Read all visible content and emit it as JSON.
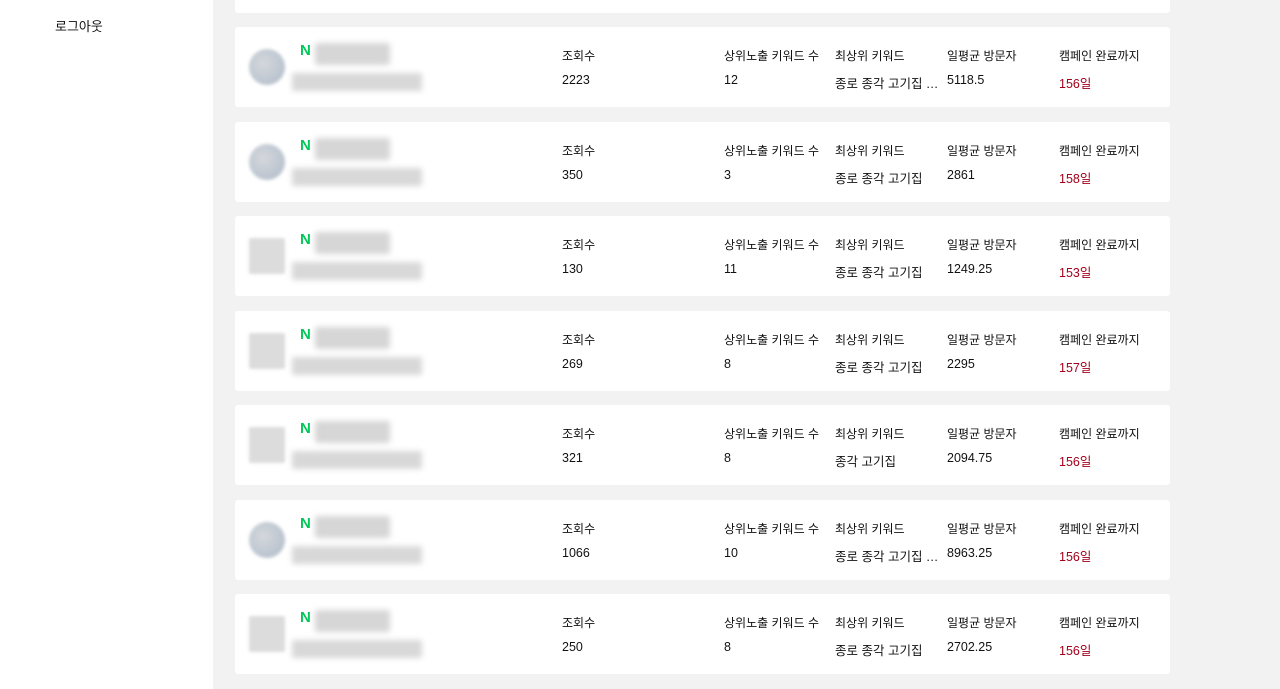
{
  "sidebar": {
    "logout_label": "로그아웃"
  },
  "labels": {
    "views": "조회수",
    "top_keywords": "상위노출 키워드 수",
    "best_keyword": "최상위 키워드",
    "daily_visitors": "일평균 방문자",
    "campaign_remaining": "캠페인 완료까지"
  },
  "brand_icon": "naver-n-icon",
  "colors": {
    "brand": "#03c75a",
    "days": "#a3001b",
    "background": "#f2f2f2"
  },
  "cards": [
    {
      "views": "2223",
      "top_keywords": "12",
      "best_keyword": "종로 종각 고기집 맛집",
      "daily_visitors": "5118.5",
      "remaining": "156일",
      "thumb": "round"
    },
    {
      "views": "350",
      "top_keywords": "3",
      "best_keyword": "종로 종각 고기집",
      "daily_visitors": "2861",
      "remaining": "158일",
      "thumb": "round"
    },
    {
      "views": "130",
      "top_keywords": "11",
      "best_keyword": "종로 종각 고기집",
      "daily_visitors": "1249.25",
      "remaining": "153일",
      "thumb": "square"
    },
    {
      "views": "269",
      "top_keywords": "8",
      "best_keyword": "종로 종각 고기집",
      "daily_visitors": "2295",
      "remaining": "157일",
      "thumb": "square"
    },
    {
      "views": "321",
      "top_keywords": "8",
      "best_keyword": "종각 고기집",
      "daily_visitors": "2094.75",
      "remaining": "156일",
      "thumb": "square"
    },
    {
      "views": "1066",
      "top_keywords": "10",
      "best_keyword": "종로 종각 고기집 맛집",
      "daily_visitors": "8963.25",
      "remaining": "156일",
      "thumb": "round"
    },
    {
      "views": "250",
      "top_keywords": "8",
      "best_keyword": "종로 종각 고기집",
      "daily_visitors": "2702.25",
      "remaining": "156일",
      "thumb": "square"
    }
  ]
}
